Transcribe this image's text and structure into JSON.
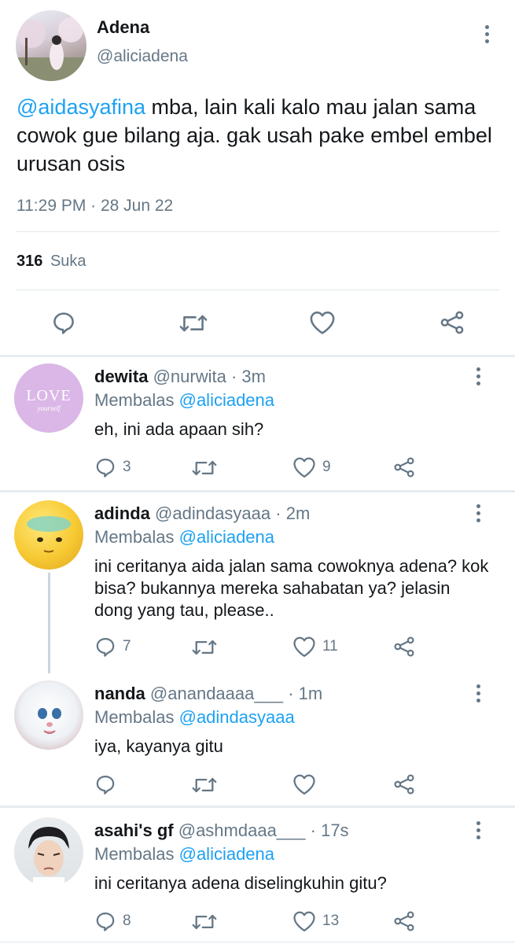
{
  "main_tweet": {
    "display_name": "Adena",
    "handle": "@aliciadena",
    "mention": "@aidasyafina",
    "text": " mba, lain kali kalo mau jalan sama cowok gue bilang aja. gak usah pake embel embel urusan osis",
    "timestamp": "11:29 PM · 28 Jun 22",
    "likes_count": "316",
    "likes_label": "Suka"
  },
  "replies": [
    {
      "name": "dewita",
      "handle": "@nurwita",
      "time": "· 3m",
      "replying_label": "Membalas",
      "replying_to": "@aliciadena",
      "text": "eh, ini ada apaan sih?",
      "reply_count": "3",
      "retweet_count": "",
      "like_count": "9",
      "avatar_text": "LOVE",
      "avatar_subtext": "yourself"
    },
    {
      "name": "adinda",
      "handle": "@adindasyaaa",
      "time": "· 2m",
      "replying_label": "Membalas",
      "replying_to": "@aliciadena",
      "text": "ini ceritanya aida jalan sama cowoknya adena? kok bisa? bukannya mereka sahabatan ya? jelasin dong yang tau, please..",
      "reply_count": "7",
      "retweet_count": "",
      "like_count": "11"
    },
    {
      "name": "nanda",
      "handle": "@anandaaaa___",
      "time": "· 1m",
      "replying_label": "Membalas",
      "replying_to": "@adindasyaaa",
      "text": "iya, kayanya gitu",
      "reply_count": "",
      "retweet_count": "",
      "like_count": ""
    },
    {
      "name": "asahi's gf",
      "handle": "@ashmdaaa___",
      "time": "· 17s",
      "replying_label": "Membalas",
      "replying_to": "@aliciadena",
      "text": "ini ceritanya adena diselingkuhin gitu?",
      "reply_count": "8",
      "retweet_count": "",
      "like_count": "13"
    }
  ],
  "colors": {
    "accent": "#1da1f2",
    "text": "#14171a",
    "secondary": "#657786",
    "divider": "#e1e8ed"
  },
  "icons": [
    "more-vertical-icon",
    "reply-icon",
    "retweet-icon",
    "like-icon",
    "share-icon"
  ]
}
